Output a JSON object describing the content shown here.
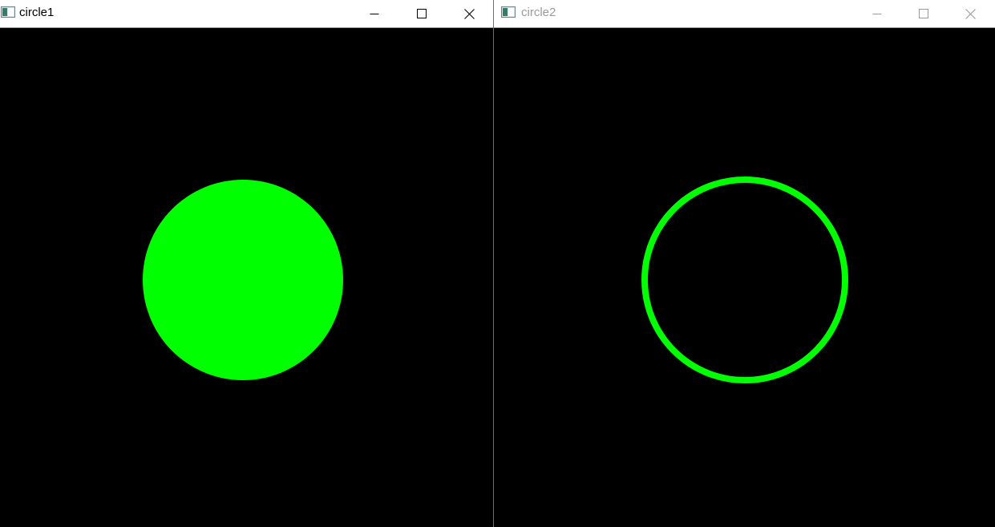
{
  "colors": {
    "circle": "#00ff00",
    "canvas_background": "#000000",
    "titlebar_active": "#ffffff",
    "titlebar_text_active": "#000000",
    "titlebar_text_inactive": "#9a9a9a"
  },
  "windows": [
    {
      "title": "circle1",
      "active": true,
      "icon": "app-window-icon",
      "controls": [
        "minimize-icon",
        "maximize-icon",
        "close-icon"
      ],
      "circle_style": "filled"
    },
    {
      "title": "circle2",
      "active": false,
      "icon": "app-window-icon",
      "controls": [
        "minimize-icon",
        "maximize-icon",
        "close-icon"
      ],
      "circle_style": "outline"
    }
  ]
}
